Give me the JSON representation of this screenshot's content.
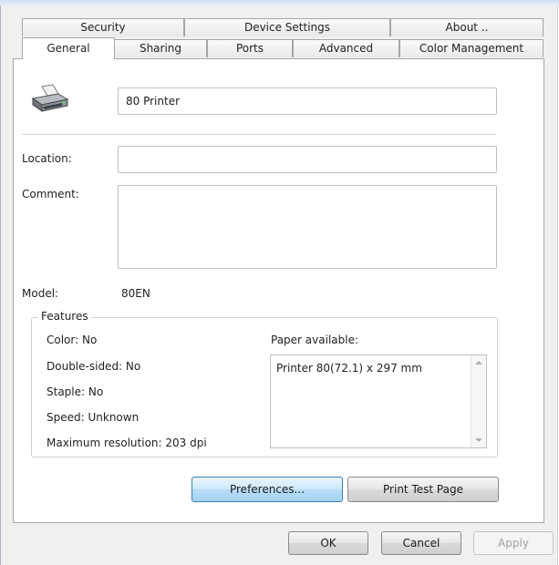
{
  "tabs_back": [
    "Security",
    "Device Settings",
    "About .."
  ],
  "tabs_front": [
    "General",
    "Sharing",
    "Ports",
    "Advanced",
    "Color Management"
  ],
  "printer_name": "80 Printer",
  "labels": {
    "location": "Location:",
    "comment": "Comment:",
    "model": "Model:",
    "features": "Features",
    "paper_available": "Paper available:"
  },
  "fields": {
    "location": "",
    "comment": ""
  },
  "model_value": "80EN",
  "features": [
    "Color: No",
    "Double-sided: No",
    "Staple: No",
    "Speed: Unknown",
    "Maximum resolution: 203 dpi"
  ],
  "paper_items": [
    "Printer 80(72.1) x 297 mm"
  ],
  "buttons": {
    "preferences": "Preferences...",
    "print_test": "Print Test Page",
    "ok": "OK",
    "cancel": "Cancel",
    "apply": "Apply"
  },
  "icons": {
    "printer": "printer-icon"
  }
}
